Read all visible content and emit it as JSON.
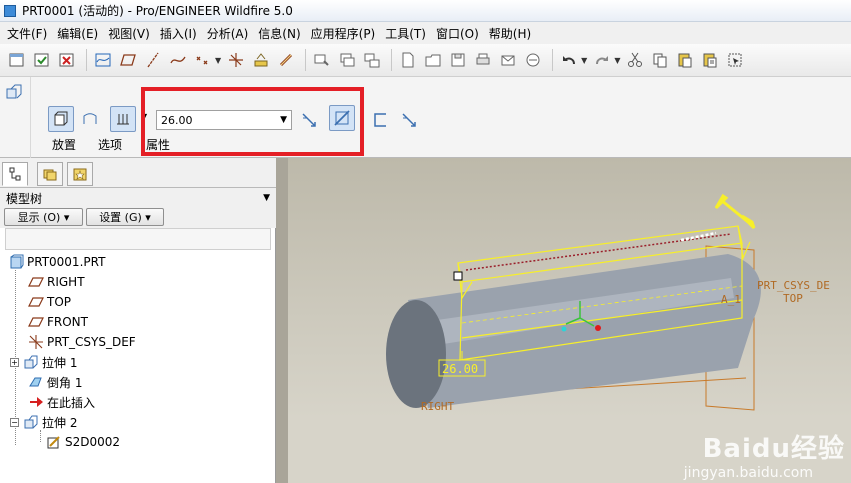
{
  "window": {
    "title": "PRT0001 (活动的) - Pro/ENGINEER Wildfire 5.0"
  },
  "menu": [
    "文件(F)",
    "编辑(E)",
    "视图(V)",
    "插入(I)",
    "分析(A)",
    "信息(N)",
    "应用程序(P)",
    "工具(T)",
    "窗口(O)",
    "帮助(H)"
  ],
  "dashboard": {
    "tabs": {
      "placement": "放置",
      "options": "选项",
      "properties": "属性"
    },
    "depth_value": "26.00"
  },
  "model_tree": {
    "title": "模型树",
    "show_button": "显示 (O) ▾",
    "settings_button": "设置 (G) ▾",
    "items": [
      {
        "label": "PRT0001.PRT"
      },
      {
        "label": "RIGHT"
      },
      {
        "label": "TOP"
      },
      {
        "label": "FRONT"
      },
      {
        "label": "PRT_CSYS_DEF"
      },
      {
        "label": "拉伸 1"
      },
      {
        "label": "倒角 1"
      },
      {
        "label": "在此插入"
      },
      {
        "label": "拉伸 2"
      },
      {
        "label": "S2D0002"
      }
    ]
  },
  "viewport": {
    "dim_label": "26.00",
    "datum_labels": {
      "csys": "PRT_CSYS_DE",
      "top": "TOP",
      "a1": "A_1",
      "right": "RIGHT"
    }
  },
  "watermark": {
    "brand": "Baidu经验",
    "url": "jingyan.baidu.com"
  },
  "colors": {
    "selection_box": "#e41f26",
    "preview_yellow": "#f7ef2a",
    "datum_orange": "#c87a2a",
    "cylinder": "#8f98a3"
  }
}
